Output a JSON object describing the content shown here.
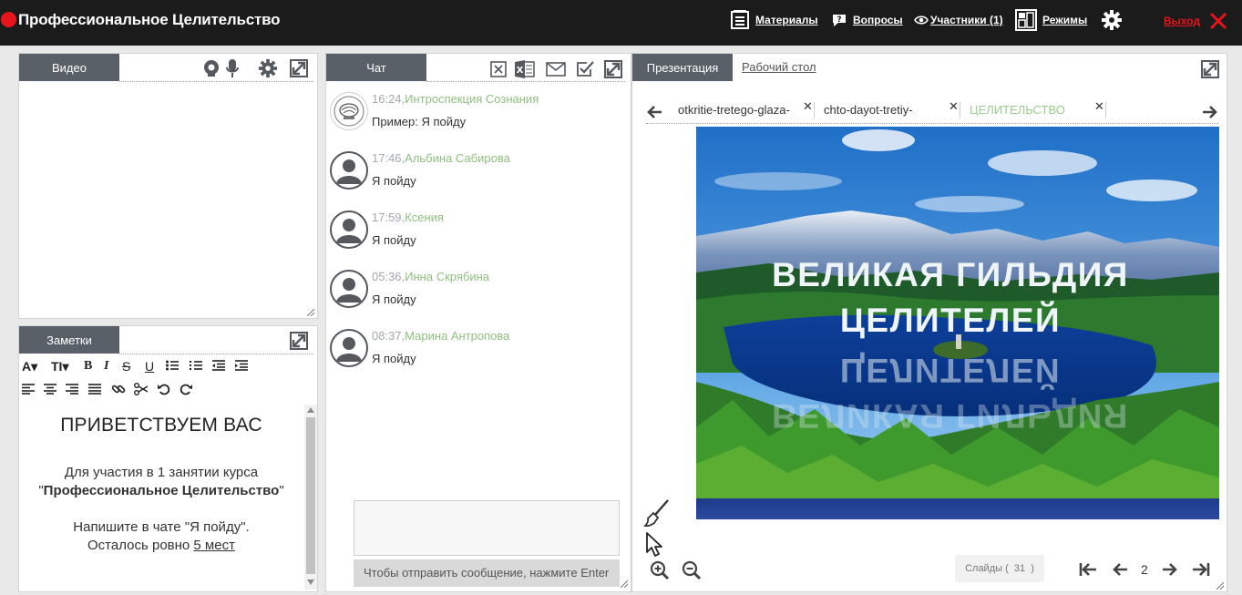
{
  "app": {
    "title": "Профессиональное Целительство",
    "colors": {
      "record": "#e8141b",
      "topbar": "#1b1b1b",
      "tab": "#5a6068",
      "name_green": "#8fbf7f"
    }
  },
  "nav": {
    "materials": "Материалы",
    "questions": "Вопросы",
    "participants": "Участники (1)",
    "modes": "Режимы",
    "exit": "Выход"
  },
  "video": {
    "tab_label": "Видео"
  },
  "notes": {
    "tab_label": "Заметки",
    "heading": "ПРИВЕТСТВУЕМ ВАС",
    "line1": "Для участия в 1 занятии курса",
    "quote_open": "\"",
    "course_name": "Профессиональное Целительство",
    "quote_close": "\"",
    "line3": "Напишите в чате \"Я пойду\".",
    "line4_prefix": "Осталось ровно ",
    "line4_link": "5 мест"
  },
  "chat": {
    "tab_label": "Чат",
    "messages": [
      {
        "time": "16:24,",
        "name": "Интроспекция Сознания",
        "text": "Пример: Я пойду"
      },
      {
        "time": "17:46,",
        "name": "Альбина Сабирова",
        "text": "Я пойду"
      },
      {
        "time": "17:59,",
        "name": "Ксения",
        "text": "Я пойду"
      },
      {
        "time": "05:36,",
        "name": "Инна Скрябина",
        "text": "Я пойду"
      },
      {
        "time": "08:37,",
        "name": "Марина Антропова",
        "text": "Я пойду"
      }
    ],
    "send_hint": "Чтобы отправить сообщение, нажмите Enter"
  },
  "presentation": {
    "tab_label": "Презентация",
    "desktop_tab": "Рабочий стол",
    "documents": [
      "otkritie-tretego-glaza-",
      "chto-dayot-tretiy-",
      "ЦЕЛИТЕЛЬСТВО"
    ],
    "slide_title_line1": "ВЕЛИКАЯ  ГИЛЬДИЯ",
    "slide_title_line2": "ЦЕЛИТЕЛЕЙ",
    "slides_label": "Слайды (",
    "slides_count": "31",
    "slides_close": ")",
    "current_page": "2"
  }
}
